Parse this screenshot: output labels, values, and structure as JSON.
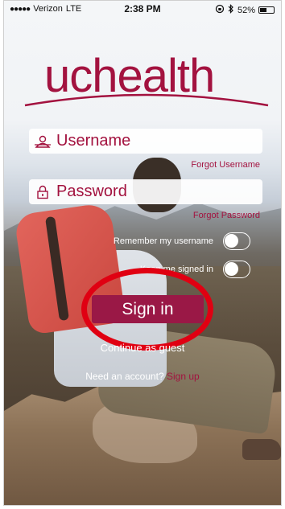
{
  "status_bar": {
    "signal_dots": "●●●●●",
    "carrier": "Verizon",
    "network": "LTE",
    "time": "2:38 PM",
    "battery_text": "52%",
    "battery_level": 0.52
  },
  "logo": {
    "text": "uchealth",
    "color": "#a3123f"
  },
  "form": {
    "username_placeholder": "Username",
    "forgot_username": "Forgot Username",
    "password_placeholder": "Password",
    "forgot_password": "Forgot Password",
    "remember_label": "Remember my username",
    "keep_signed_label": "Keep me signed in",
    "signin_label": "Sign in",
    "guest_label": "Continue as guest",
    "account_prompt": "Need an account?",
    "signup_label": "Sign up"
  },
  "colors": {
    "brand": "#a3123f",
    "button": "#9a1846",
    "highlight": "#e00012"
  }
}
